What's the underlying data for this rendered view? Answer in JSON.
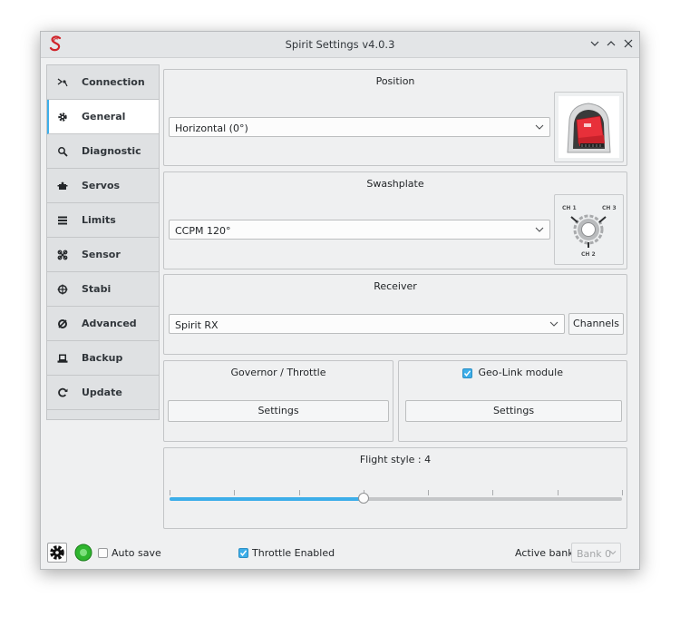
{
  "window": {
    "title": "Spirit Settings v4.0.3"
  },
  "sidebar": {
    "items": [
      {
        "label": "Connection",
        "icon": "connection-icon"
      },
      {
        "label": "General",
        "icon": "gear-icon"
      },
      {
        "label": "Diagnostic",
        "icon": "magnifier-icon"
      },
      {
        "label": "Servos",
        "icon": "servo-icon"
      },
      {
        "label": "Limits",
        "icon": "limits-icon"
      },
      {
        "label": "Sensor",
        "icon": "sensor-icon"
      },
      {
        "label": "Stabi",
        "icon": "crosshair-icon"
      },
      {
        "label": "Advanced",
        "icon": "advanced-icon"
      },
      {
        "label": "Backup",
        "icon": "backup-icon"
      },
      {
        "label": "Update",
        "icon": "refresh-icon"
      }
    ],
    "active": "General"
  },
  "position": {
    "title": "Position",
    "value": "Horizontal (0°)"
  },
  "swashplate": {
    "title": "Swashplate",
    "value": "CCPM 120°",
    "ch1": "CH 1",
    "ch2": "CH 2",
    "ch3": "CH 3"
  },
  "receiver": {
    "title": "Receiver",
    "value": "Spirit RX",
    "channels_label": "Channels"
  },
  "governor": {
    "title": "Governor / Throttle",
    "settings_label": "Settings"
  },
  "geolink": {
    "title": "Geo-Link module",
    "checked": true,
    "settings_label": "Settings"
  },
  "flight_style": {
    "title": "Flight style : 4",
    "value": 4,
    "min": 1,
    "max": 8
  },
  "status": {
    "auto_save_label": "Auto save",
    "auto_save_checked": false,
    "throttle_label": "Throttle Enabled",
    "throttle_checked": true,
    "active_bank_label": "Active bank:",
    "active_bank_value": "Bank 0"
  },
  "colors": {
    "accent": "#3daee9",
    "connected": "#2fb52f",
    "unit_red": "#e8303a"
  }
}
